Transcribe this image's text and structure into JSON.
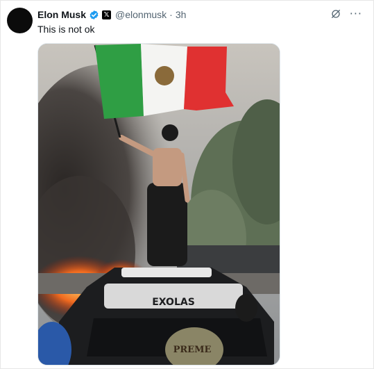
{
  "tweet": {
    "author_name": "Elon Musk",
    "handle": "@elonmusk",
    "separator": "·",
    "time": "3h",
    "affiliation_badge": "𝕏",
    "text": "This is not ok"
  },
  "media": {
    "car_roof_text": "EXOLAS",
    "cap_text": "PREME"
  },
  "icons": {
    "verified": "verified-badge-icon",
    "grok": "grok-icon",
    "more": "more-icon",
    "more_glyph": "···"
  },
  "colors": {
    "verified_blue": "#1d9bf0",
    "text_primary": "#0f1419",
    "text_secondary": "#536471",
    "flag_green": "#2f9e44",
    "flag_red": "#e03131"
  }
}
